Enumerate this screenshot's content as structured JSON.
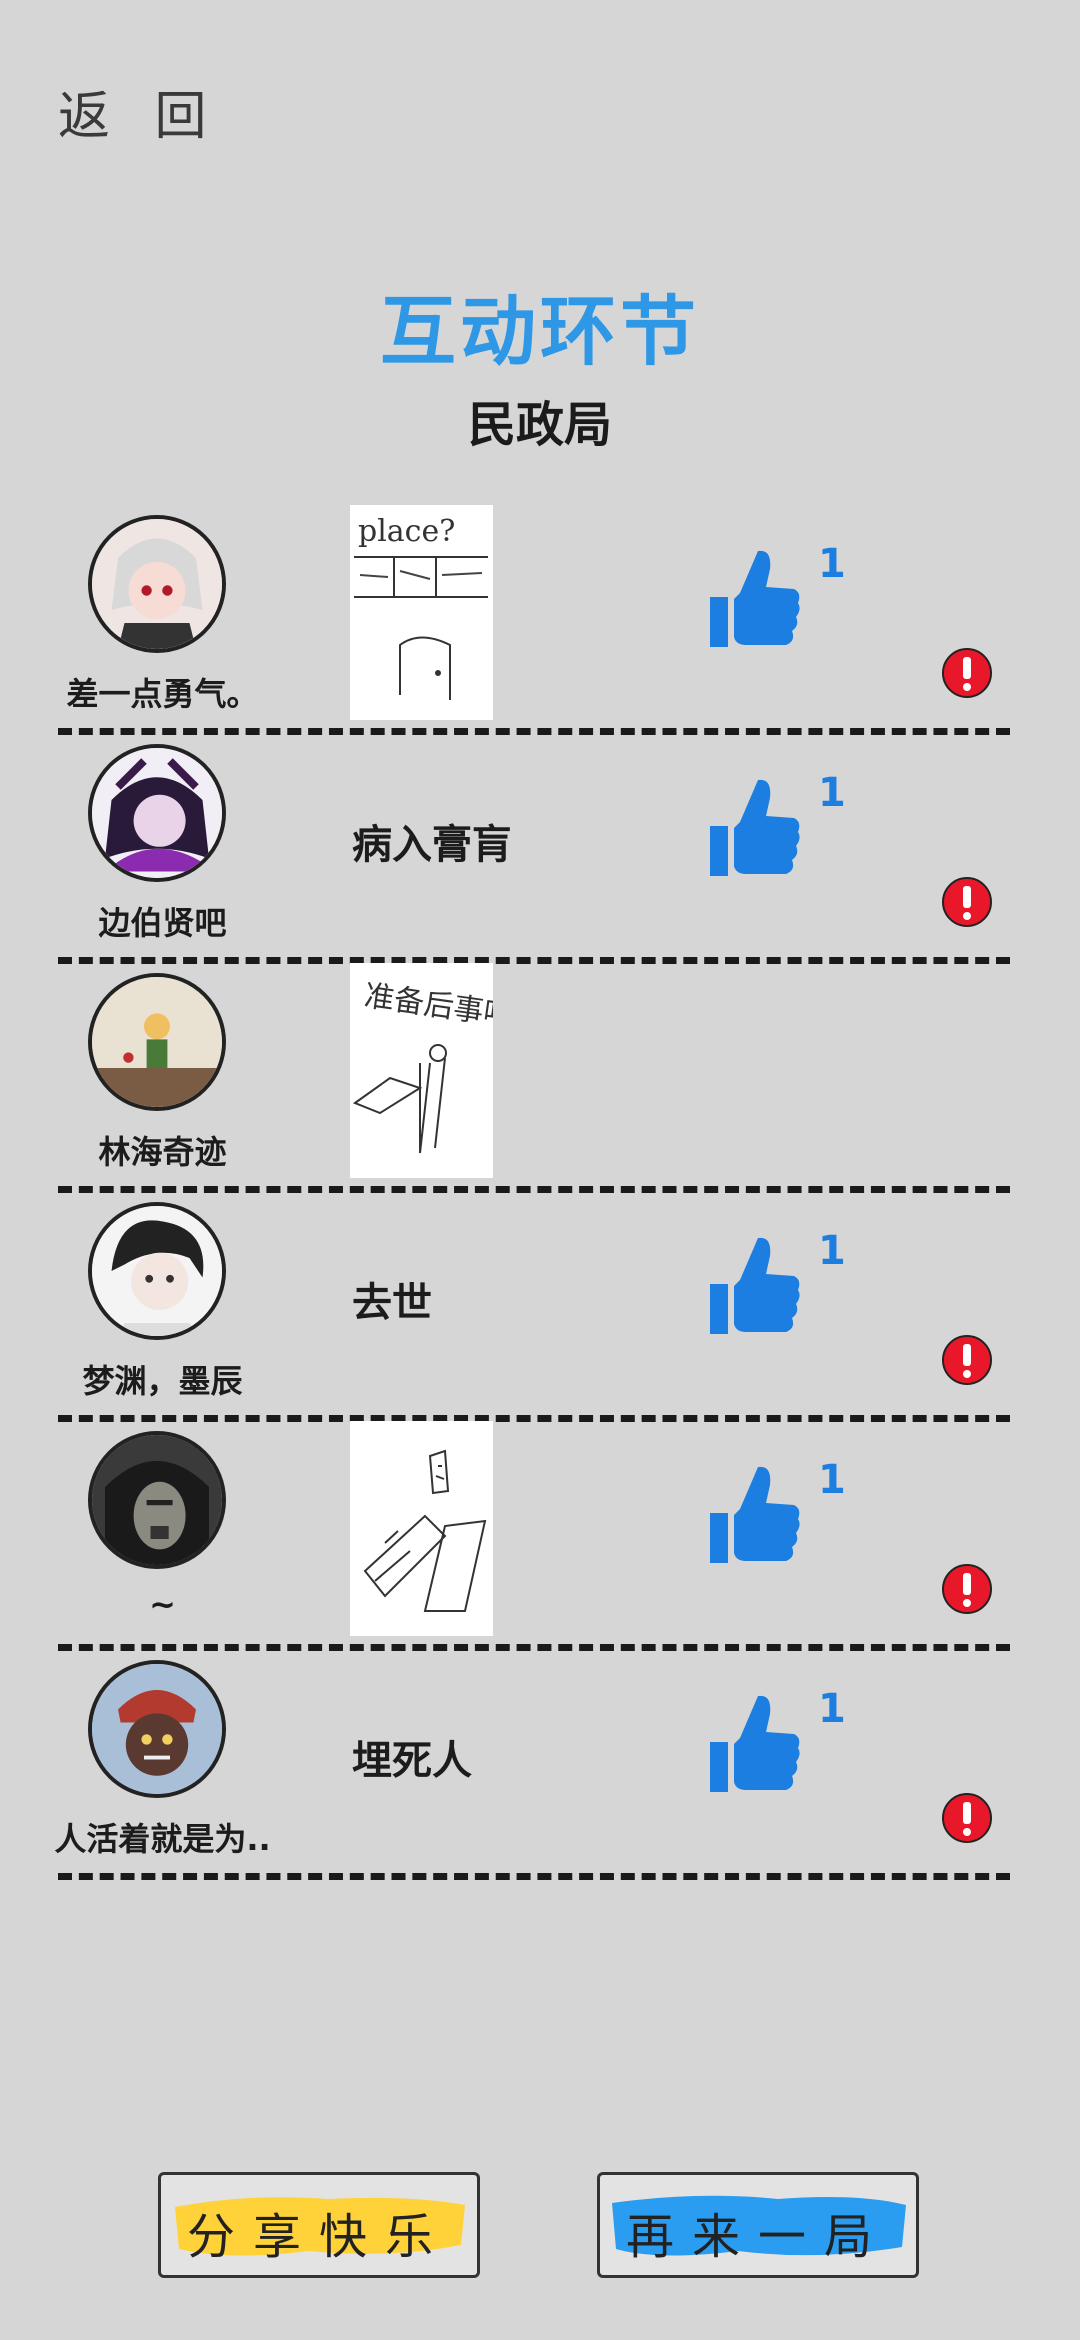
{
  "header": {
    "back_label": "返 回"
  },
  "title": "互动环节",
  "subtitle": "民政局",
  "rows": [
    {
      "username": "差一点勇气。",
      "answer": "",
      "drawing_text": "place?",
      "likes": "1",
      "has_like": true,
      "avatar_color": "#c9a3a8"
    },
    {
      "username": "边伯贤吧",
      "answer": "病入膏肓",
      "likes": "1",
      "has_like": true,
      "avatar_color": "#5a2a6e"
    },
    {
      "username": "林海奇迹",
      "answer": "",
      "drawing_text": "准备后事吧",
      "likes": "",
      "has_like": false,
      "avatar_color": "#b8a58a"
    },
    {
      "username": "梦渊，墨辰",
      "answer": "去世",
      "likes": "1",
      "has_like": true,
      "avatar_color": "#e8e8e8"
    },
    {
      "username": "~",
      "answer": "",
      "drawing_text": "",
      "likes": "1",
      "has_like": true,
      "avatar_color": "#2b2b2b"
    },
    {
      "username": "人活着就是为..",
      "answer": "埋死人",
      "likes": "1",
      "has_like": true,
      "avatar_color": "#8fa6c2"
    }
  ],
  "buttons": {
    "share_label": "分享快乐",
    "again_label": "再来一局"
  },
  "colors": {
    "accent": "#2e98e6",
    "like": "#1b7ee0",
    "report": "#e8182a",
    "share": "#ffd23a",
    "again": "#2a9df0"
  }
}
